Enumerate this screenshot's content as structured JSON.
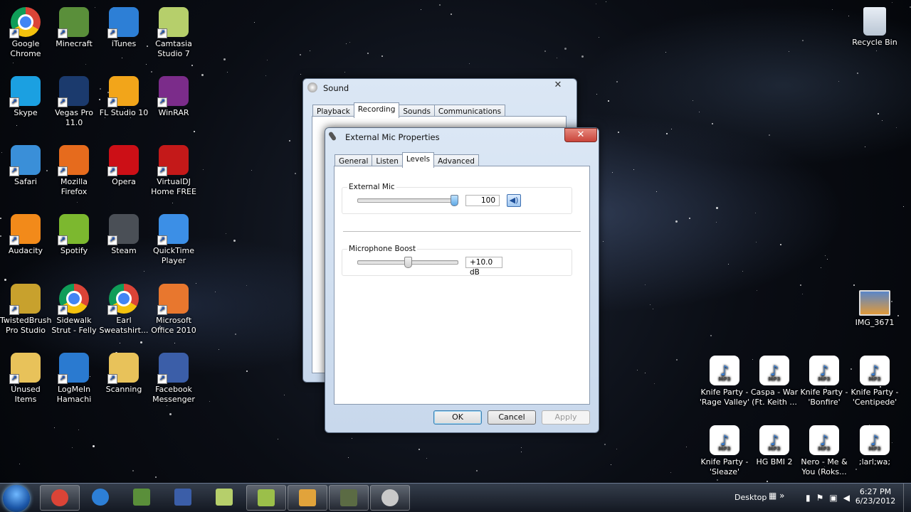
{
  "desktop": {
    "icons_left": [
      {
        "label": "Google Chrome",
        "icon": "chrome-icon",
        "color": "#ffffff"
      },
      {
        "label": "Minecraft",
        "icon": "minecraft-icon",
        "color": "#5a8f3a"
      },
      {
        "label": "iTunes",
        "icon": "itunes-icon",
        "color": "#2d7fd6"
      },
      {
        "label": "Camtasia Studio 7",
        "icon": "camtasia-icon",
        "color": "#b6cf6b"
      },
      {
        "label": "Skype",
        "icon": "skype-icon",
        "color": "#1ba0e1"
      },
      {
        "label": "Vegas Pro 11.0",
        "icon": "vegas-icon",
        "color": "#1b3a6d"
      },
      {
        "label": "FL Studio 10",
        "icon": "flstudio-icon",
        "color": "#f2a51a"
      },
      {
        "label": "WinRAR",
        "icon": "winrar-icon",
        "color": "#7b2c8a"
      },
      {
        "label": "Safari",
        "icon": "safari-icon",
        "color": "#3a8fd8"
      },
      {
        "label": "Mozilla Firefox",
        "icon": "firefox-icon",
        "color": "#e66b1d"
      },
      {
        "label": "Opera",
        "icon": "opera-icon",
        "color": "#cc0f16"
      },
      {
        "label": "VirtualDJ Home FREE",
        "icon": "virtualdj-icon",
        "color": "#c41919"
      },
      {
        "label": "Audacity",
        "icon": "audacity-icon",
        "color": "#f28a1a"
      },
      {
        "label": "Spotify",
        "icon": "spotify-icon",
        "color": "#7cb82f"
      },
      {
        "label": "Steam",
        "icon": "steam-icon",
        "color": "#4a4f56"
      },
      {
        "label": "QuickTime Player",
        "icon": "quicktime-icon",
        "color": "#3c8fe6"
      },
      {
        "label": "TwistedBrush Pro Studio",
        "icon": "twistedbrush-icon",
        "color": "#c8a12d"
      },
      {
        "label": "Sidewalk Strut - Felly",
        "icon": "chrome-icon",
        "color": "#ffffff"
      },
      {
        "label": "Earl Sweatshirt...",
        "icon": "chrome-icon",
        "color": "#ffffff"
      },
      {
        "label": "Microsoft Office 2010",
        "icon": "office-icon",
        "color": "#e8772e"
      },
      {
        "label": "Unused Items",
        "icon": "folder-icon",
        "color": "#e8c25a"
      },
      {
        "label": "LogMeIn Hamachi",
        "icon": "hamachi-icon",
        "color": "#2a7ad0"
      },
      {
        "label": "Scanning",
        "icon": "scanning-icon",
        "color": "#e8c25a"
      },
      {
        "label": "Facebook Messenger",
        "icon": "messenger-icon",
        "color": "#3b5ea8"
      }
    ],
    "recycle_bin": "Recycle Bin",
    "img_file": "IMG_3671",
    "mp3_files": [
      "Knife Party - 'Rage Valley'",
      "Caspa - War (Ft. Keith ...",
      "Knife Party - 'Bonfire'",
      "Knife Party - 'Centipede'",
      "Knife Party - 'Sleaze'",
      "HG BMI 2",
      "Nero - Me & You (Roks...",
      ";larl;wa;"
    ],
    "mp3_tag": "MP3"
  },
  "sound_window": {
    "title": "Sound",
    "tabs": [
      "Playback",
      "Recording",
      "Sounds",
      "Communications"
    ],
    "active_tab": "Recording"
  },
  "mic_window": {
    "title": "External Mic Properties",
    "tabs": [
      "General",
      "Listen",
      "Levels",
      "Advanced"
    ],
    "active_tab": "Levels",
    "external_mic": {
      "label": "External Mic",
      "value": "100",
      "level_fraction": 1.0
    },
    "boost": {
      "label": "Microphone Boost",
      "value": "+10.0 dB",
      "level_fraction": 0.5
    },
    "buttons": {
      "ok": "OK",
      "cancel": "Cancel",
      "apply": "Apply"
    }
  },
  "taskbar": {
    "desktop_label": "Desktop",
    "time": "6:27 PM",
    "date": "6/23/2012",
    "apps": [
      "chrome-icon",
      "itunes-icon",
      "minecraft-icon",
      "messenger-icon",
      "camtasia-icon",
      "camtasia-recorder-icon",
      "paint-icon",
      "recorder-icon",
      "sound-icon"
    ]
  },
  "colors": {
    "close": "#c9443a",
    "accent": "#3c7fb1"
  }
}
